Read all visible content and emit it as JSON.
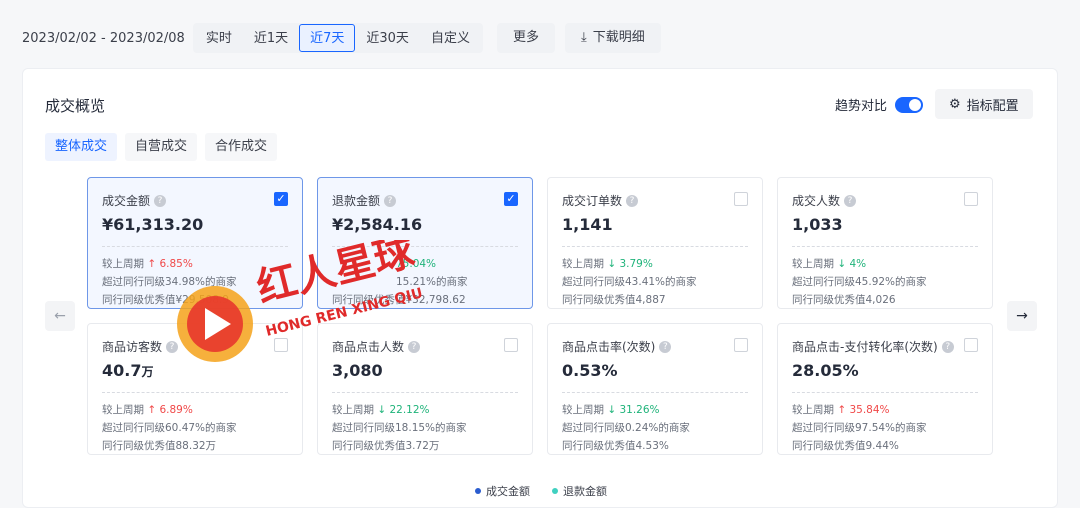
{
  "toolbar": {
    "date_range": "2023/02/02 - 2023/02/08",
    "tabs": [
      "实时",
      "近1天",
      "近7天",
      "近30天",
      "自定义"
    ],
    "more": "更多",
    "download": "下载明细"
  },
  "panel": {
    "title": "成交概览",
    "trend_label": "趋势对比",
    "config_label": "指标配置",
    "sub_tabs": [
      "整体成交",
      "自营成交",
      "合作成交"
    ]
  },
  "cards": [
    {
      "name": "成交金额",
      "value": "¥61,313.20",
      "period_label": "较上周期",
      "change": "6.85%",
      "line2": "超过同行同级34.98%的商家",
      "line3": "同行同级优秀值¥29,508.9"
    },
    {
      "name": "退款金额",
      "value": "¥2,584.16",
      "period_label": "",
      "change": "75.04%",
      "line2": "15.21%的商家",
      "line3": "同行同级优秀值¥32,798.62"
    },
    {
      "name": "成交订单数",
      "value": "1,141",
      "period_label": "较上周期",
      "change": "3.79%",
      "line2": "超过同行同级43.41%的商家",
      "line3": "同行同级优秀值4,887"
    },
    {
      "name": "成交人数",
      "value": "1,033",
      "period_label": "较上周期",
      "change": "4%",
      "line2": "超过同行同级45.92%的商家",
      "line3": "同行同级优秀值4,026"
    },
    {
      "name": "商品访客数",
      "value": "40.7",
      "unit": "万",
      "period_label": "较上周期",
      "change": "6.89%",
      "line2": "超过同行同级60.47%的商家",
      "line3": "同行同级优秀值88.32万"
    },
    {
      "name": "商品点击人数",
      "value": "3,080",
      "period_label": "较上周期",
      "change": "22.12%",
      "line2": "超过同行同级18.15%的商家",
      "line3": "同行同级优秀值3.72万"
    },
    {
      "name": "商品点击率(次数)",
      "value": "0.53%",
      "period_label": "较上周期",
      "change": "31.26%",
      "line2": "超过同行同级0.24%的商家",
      "line3": "同行同级优秀值4.53%"
    },
    {
      "name": "商品点击-支付转化率(次数)",
      "value": "28.05%",
      "period_label": "较上周期",
      "change": "35.84%",
      "line2": "超过同行同级97.54%的商家",
      "line3": "同行同级优秀值9.44%"
    }
  ],
  "legend": [
    "成交金额",
    "退款金额"
  ],
  "watermark": {
    "title": "红人星球",
    "subtitle": "HONG REN XING QIU"
  },
  "colors": {
    "accent": "#1966ff",
    "up": "#f04848",
    "down": "#1fb37a",
    "legend_1": "#2a5ccf",
    "legend_2": "#3fd0c0"
  },
  "icons": {
    "download": "download-icon",
    "config": "gear-icon",
    "help": "question-circle-icon",
    "nav_left": "arrow-left-icon",
    "nav_right": "arrow-right-icon"
  }
}
